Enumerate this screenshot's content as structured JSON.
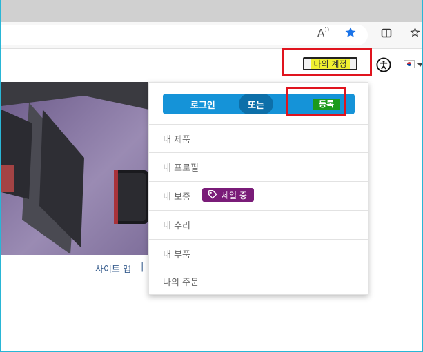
{
  "browser": {
    "toolbar": {
      "read_aloud_label": "A",
      "icons": [
        "read-aloud-icon",
        "favorite-star-icon",
        "split-screen-icon",
        "favorites-icon"
      ],
      "accent_color": "#1a73e8"
    }
  },
  "header": {
    "my_account_label": "나의 계정",
    "accessibility_icon": "accessibility-icon",
    "country_flag": "flag-icon"
  },
  "dropdown": {
    "login_label": "로그인",
    "or_label": "또는",
    "register_label": "등록",
    "items": [
      {
        "label": "내 제품"
      },
      {
        "label": "내 프로필"
      },
      {
        "label": "내 보증",
        "badge": "세일 중"
      },
      {
        "label": "내 수리"
      },
      {
        "label": "내 부품"
      },
      {
        "label": "나의 주문"
      }
    ]
  },
  "footer": {
    "sitemap_label": "사이트 맵",
    "separator": "|"
  },
  "colors": {
    "login_blue": "#1593d8",
    "or_blue": "#0d6fa9",
    "register_green": "#1c9a1c",
    "sale_purple": "#7a1c78",
    "highlight_red": "#e0141e",
    "highlight_yellow": "#f0f030",
    "frame_cyan": "#29b6d6"
  }
}
